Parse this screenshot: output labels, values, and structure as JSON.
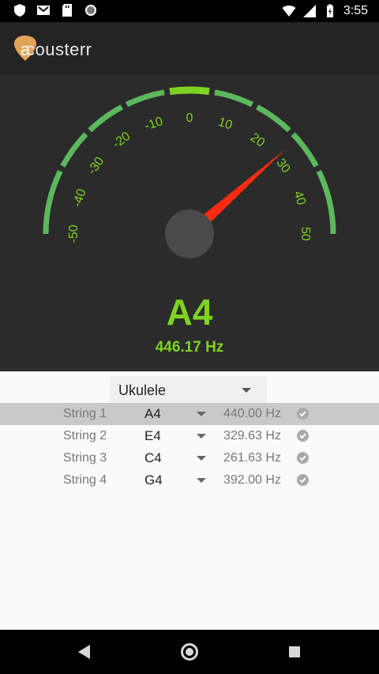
{
  "status_bar": {
    "time": "3:55",
    "icons": [
      "shield-icon",
      "gmail-icon",
      "sd-card-icon",
      "circle-icon",
      "wifi-icon",
      "signal-icon",
      "battery-icon"
    ]
  },
  "app_bar": {
    "logo_letter": "a",
    "logo_text": "cousterr"
  },
  "tuner": {
    "scale": [
      "-50",
      "-40",
      "-30",
      "-20",
      "-10",
      "0",
      "10",
      "20",
      "30",
      "40",
      "50"
    ],
    "needle_cents": 27,
    "note": "A4",
    "frequency": "446.17 Hz",
    "colors": {
      "accent": "#7ed321",
      "arc": "#5cb85c",
      "needle": "#ff2a12"
    }
  },
  "instrument": {
    "selected": "Ukulele"
  },
  "strings": [
    {
      "label": "String 1",
      "note": "A4",
      "hz": "440.00 Hz",
      "selected": true
    },
    {
      "label": "String 2",
      "note": "E4",
      "hz": "329.63 Hz",
      "selected": false
    },
    {
      "label": "String 3",
      "note": "C4",
      "hz": "261.63 Hz",
      "selected": false
    },
    {
      "label": "String 4",
      "note": "G4",
      "hz": "392.00 Hz",
      "selected": false
    }
  ],
  "nav": {
    "icons": [
      "back-icon",
      "home-icon",
      "recents-icon"
    ]
  }
}
